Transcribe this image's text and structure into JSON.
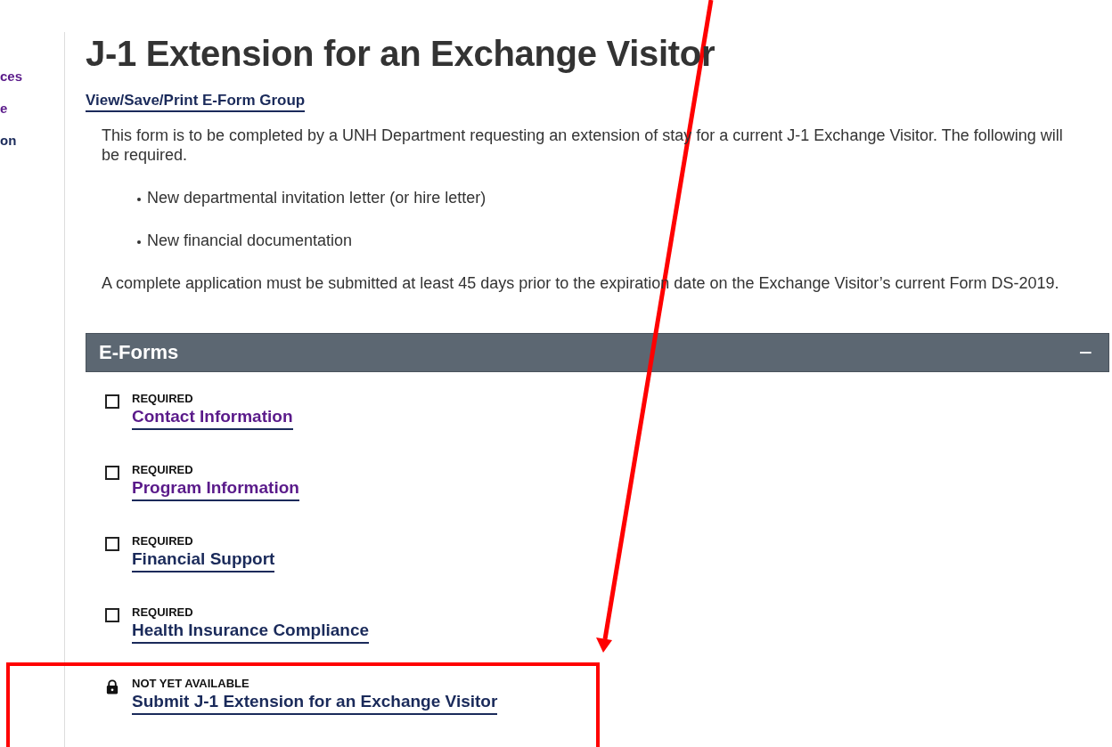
{
  "sidebar": {
    "items": [
      {
        "label": "ces",
        "visited": true
      },
      {
        "label": "e",
        "visited": true
      },
      {
        "label": "on",
        "visited": false
      }
    ]
  },
  "title": "J-1 Extension for an Exchange Visitor",
  "group_link": "View/Save/Print E-Form Group",
  "intro": "This form is to be completed by a UNH Department requesting an extension of stay for a current J-1 Exchange Visitor. The following will be required.",
  "requirements": [
    "New departmental invitation letter (or hire letter)",
    "New financial documentation"
  ],
  "note": "A complete application must be submitted at least 45 days prior to the expiration date on the Exchange Visitor’s current Form DS-2019.",
  "eforms": {
    "title": "E-Forms",
    "toggle": "−",
    "expanded": true,
    "items": [
      {
        "kind": "checkbox",
        "checked": false,
        "status": "REQUIRED",
        "label": "Contact Information",
        "visited": true,
        "highlighted": false
      },
      {
        "kind": "checkbox",
        "checked": false,
        "status": "REQUIRED",
        "label": "Program Information",
        "visited": true,
        "highlighted": false
      },
      {
        "kind": "checkbox",
        "checked": false,
        "status": "REQUIRED",
        "label": "Financial Support",
        "visited": false,
        "highlighted": false
      },
      {
        "kind": "checkbox",
        "checked": false,
        "status": "REQUIRED",
        "label": "Health Insurance Compliance",
        "visited": false,
        "highlighted": false
      },
      {
        "kind": "locked",
        "status": "NOT YET AVAILABLE",
        "label": "Submit J-1 Extension for an Exchange Visitor",
        "visited": false,
        "highlighted": true
      }
    ]
  }
}
